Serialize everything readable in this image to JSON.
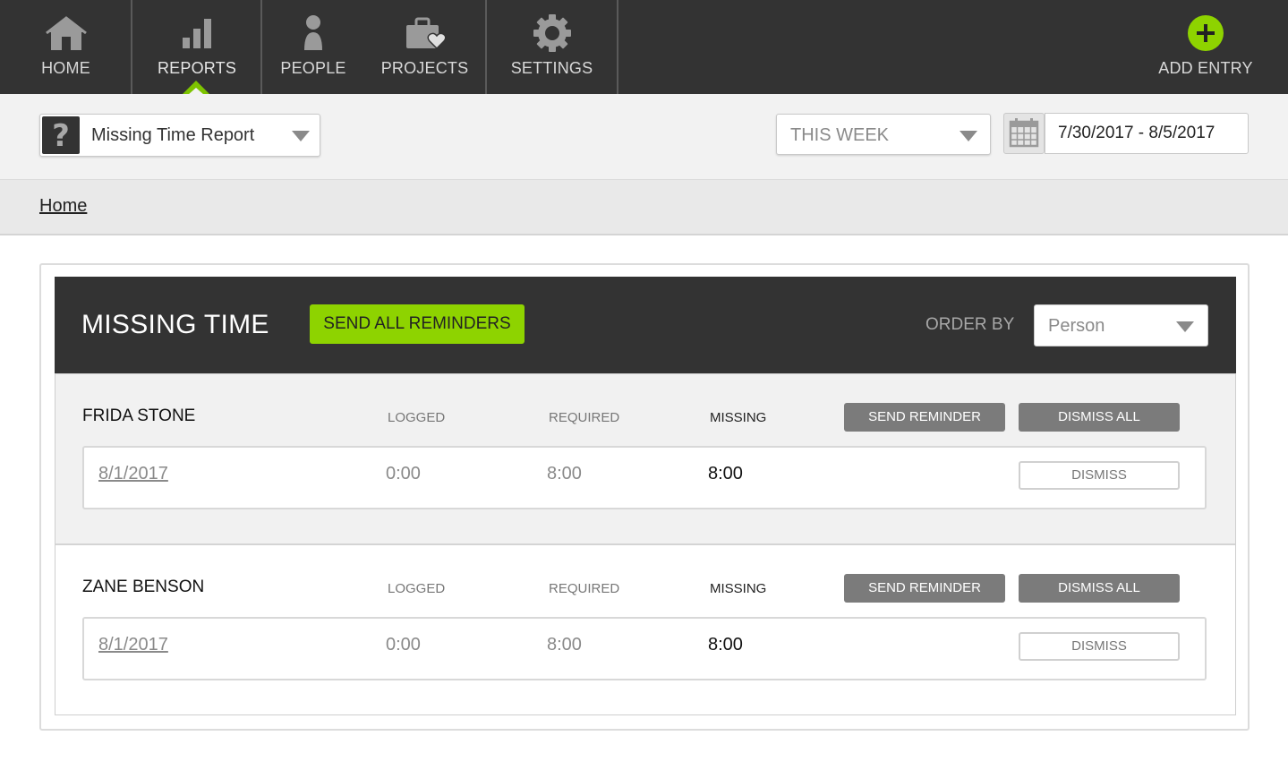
{
  "nav": {
    "items": [
      {
        "label": "HOME",
        "icon": "home-icon"
      },
      {
        "label": "REPORTS",
        "icon": "bar-chart-icon"
      },
      {
        "label": "PEOPLE",
        "icon": "person-icon"
      },
      {
        "label": "PROJECTS",
        "icon": "briefcase-heart-icon"
      },
      {
        "label": "SETTINGS",
        "icon": "gear-icon"
      }
    ],
    "add_entry_label": "ADD ENTRY",
    "active": "REPORTS",
    "accent_color": "#8ed300"
  },
  "toolbar": {
    "report_select_value": "Missing Time Report",
    "range_select_value": "THIS WEEK",
    "date_range": "7/30/2017 - 8/5/2017"
  },
  "breadcrumb": {
    "home_label": "Home"
  },
  "missing_time": {
    "title": "MISSING TIME",
    "send_all_label": "SEND ALL REMINDERS",
    "order_by_label": "ORDER BY",
    "order_by_value": "Person",
    "columns": {
      "logged": "LOGGED",
      "required": "REQUIRED",
      "missing": "MISSING"
    },
    "send_reminder_label": "SEND REMINDER",
    "dismiss_all_label": "DISMISS ALL",
    "dismiss_label": "DISMISS",
    "people": [
      {
        "name": "FRIDA STONE",
        "entries": [
          {
            "date": "8/1/2017",
            "logged": "0:00",
            "required": "8:00",
            "missing": "8:00"
          }
        ]
      },
      {
        "name": "ZANE BENSON",
        "entries": [
          {
            "date": "8/1/2017",
            "logged": "0:00",
            "required": "8:00",
            "missing": "8:00"
          }
        ]
      }
    ]
  }
}
